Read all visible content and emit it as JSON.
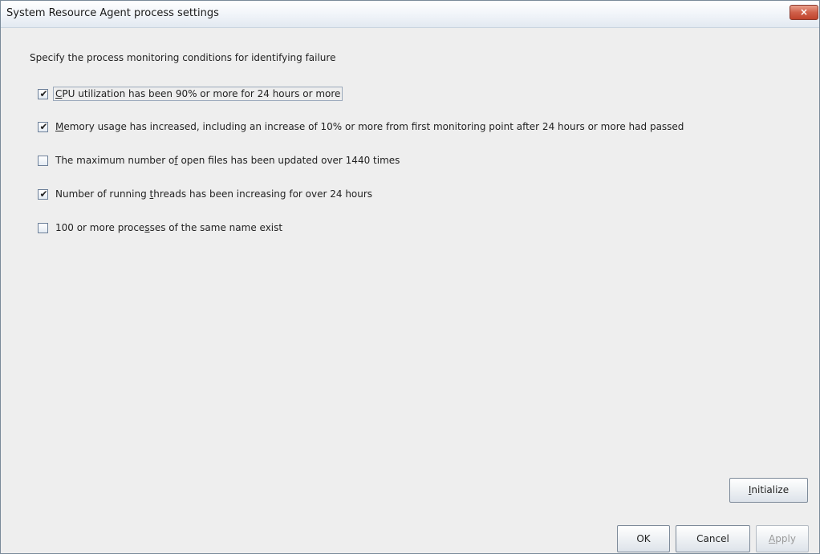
{
  "window": {
    "title": "System Resource Agent process settings",
    "close_label": "×"
  },
  "instruction": "Specify the process monitoring conditions for identifying failure",
  "conditions": [
    {
      "checked": true,
      "focused": true,
      "label_before": "",
      "mnemonic": "C",
      "label_after": "PU utilization has been 90% or more for 24 hours or more"
    },
    {
      "checked": true,
      "focused": false,
      "label_before": "",
      "mnemonic": "M",
      "label_after": "emory usage has increased, including an increase of 10% or more from first monitoring point after 24 hours or more had passed"
    },
    {
      "checked": false,
      "focused": false,
      "label_before": "The maximum number o",
      "mnemonic": "f",
      "label_after": " open files has been updated over 1440 times"
    },
    {
      "checked": true,
      "focused": false,
      "label_before": "Number of running ",
      "mnemonic": "t",
      "label_after": "hreads has been increasing for over 24 hours"
    },
    {
      "checked": false,
      "focused": false,
      "label_before": "100 or more proce",
      "mnemonic": "s",
      "label_after": "ses of the same name exist"
    }
  ],
  "check_mark": "✔",
  "buttons": {
    "initialize": {
      "mnemonic": "I",
      "rest": "nitialize"
    },
    "ok": "OK",
    "cancel": "Cancel",
    "apply": {
      "mnemonic": "A",
      "rest": "pply"
    }
  }
}
